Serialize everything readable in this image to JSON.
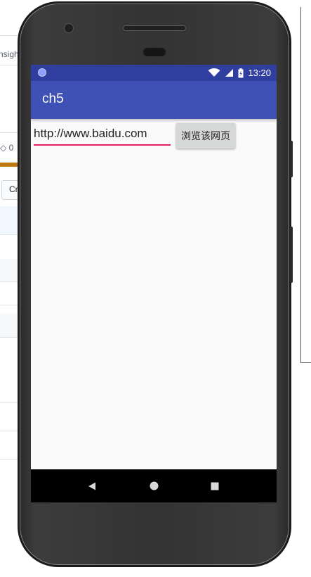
{
  "background_page": {
    "fragment_top": "nsigh",
    "fragment_count": "0",
    "fragment_button": "Cr"
  },
  "status_bar": {
    "time": "13:20",
    "icons": [
      "notification-dot-icon",
      "wifi-icon",
      "signal-icon",
      "battery-icon"
    ]
  },
  "app_bar": {
    "title": "ch5"
  },
  "form": {
    "url_value": "http://www.baidu.com",
    "browse_button_label": "浏览该网页"
  },
  "nav_bar": {
    "buttons": [
      "back-icon",
      "home-icon",
      "recents-icon"
    ]
  },
  "colors": {
    "status_bar": "#303f9f",
    "app_bar": "#3f51b5",
    "accent_underline": "#e91e63",
    "button_bg": "#d6d7d7"
  }
}
